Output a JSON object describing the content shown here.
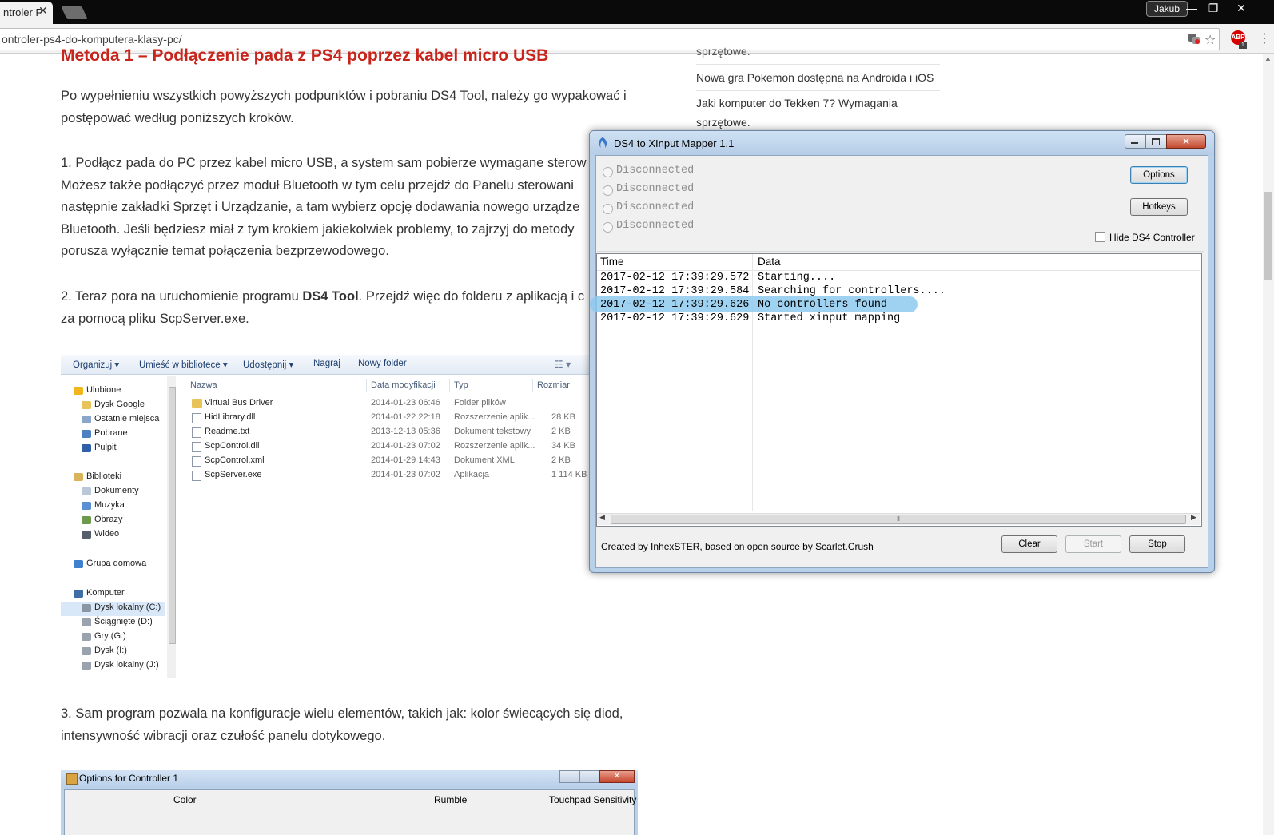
{
  "browser": {
    "tab_title": "ntroler P",
    "tab_close": "✕",
    "url": "ontroler-ps4-do-komputera-klasy-pc/",
    "profile": "Jakub",
    "controls": {
      "minimize": "—",
      "restore": "❐",
      "close": "✕"
    },
    "abp_label": "ABP",
    "abp_badge": "1"
  },
  "article": {
    "heading": "Metoda 1 – Podłączenie pada z PS4 poprzez kabel micro USB",
    "intro": [
      "Po wypełnieniu wszystkich powyższych podpunktów i pobraniu DS4 Tool, należy go wypakować i",
      "postępować według poniższych kroków."
    ],
    "step1": [
      "1. Podłącz pada do PC przez kabel micro USB, a system sam pobierze wymagane sterow",
      "Możesz także podłączyć przez moduł Bluetooth w tym celu przejdź do Panelu sterowani",
      "następnie zakładki Sprzęt i Urządzanie, a tam wybierz opcję dodawania nowego urządze",
      "Bluetooth. Jeśli będziesz miał z tym krokiem jakiekolwiek problemy, to zajrzyj do metody",
      "porusza wyłącznie temat połączenia bezprzewodowego."
    ],
    "step2": {
      "pre": "2. Teraz pora na uruchomienie programu ",
      "bold": "DS4 Tool",
      "post": ". Przejdź więc do folderu z aplikacją i c",
      "line2": "za pomocą pliku ScpServer.exe."
    },
    "step3": [
      "3. Sam program pozwala na konfiguracje wielu elementów, takich jak: kolor świecących się diod,",
      "intensywność wibracji oraz czułość panelu dotykowego."
    ]
  },
  "sidebar": {
    "items": [
      "sprzętowe.",
      "Nowa gra Pokemon dostępna na Androida i iOS",
      "Jaki komputer do Tekken 7? Wymagania",
      "sprzętowe."
    ]
  },
  "explorer": {
    "toolbar": [
      "Organizuj ▾",
      "Umieść w bibliotece ▾",
      "Udostępnij ▾",
      "Nagraj",
      "Nowy folder"
    ],
    "columns": [
      "Nazwa",
      "Data modyfikacji",
      "Typ",
      "Rozmiar"
    ],
    "nav": [
      {
        "label": "Ulubione",
        "icon": "star-icon",
        "color": "#f3b51c",
        "indent": 0
      },
      {
        "label": "Dysk Google",
        "icon": "folder-icon",
        "color": "#e8c35a",
        "indent": 1
      },
      {
        "label": "Ostatnie miejsca",
        "icon": "folder-icon",
        "color": "#8aa6c8",
        "indent": 1
      },
      {
        "label": "Pobrane",
        "icon": "folder-icon",
        "color": "#4c7fc4",
        "indent": 1
      },
      {
        "label": "Pulpit",
        "icon": "folder-icon",
        "color": "#2f5fa6",
        "indent": 1
      },
      {
        "label": "Biblioteki",
        "icon": "library-icon",
        "color": "#d9b45a",
        "indent": 0
      },
      {
        "label": "Dokumenty",
        "icon": "document-icon",
        "color": "#b9c7d8",
        "indent": 1
      },
      {
        "label": "Muzyka",
        "icon": "music-icon",
        "color": "#5a8fd6",
        "indent": 1
      },
      {
        "label": "Obrazy",
        "icon": "image-icon",
        "color": "#6b9a4a",
        "indent": 1
      },
      {
        "label": "Wideo",
        "icon": "video-icon",
        "color": "#555e6a",
        "indent": 1
      },
      {
        "label": "Grupa domowa",
        "icon": "homegroup-icon",
        "color": "#3f7fcf",
        "indent": 0
      },
      {
        "label": "Komputer",
        "icon": "computer-icon",
        "color": "#3e6ea6",
        "indent": 0
      },
      {
        "label": "Dysk lokalny (C:)",
        "icon": "drive-icon",
        "color": "#8a96a4",
        "indent": 1,
        "selected": true
      },
      {
        "label": "Ściągnięte (D:)",
        "icon": "drive-icon",
        "color": "#9aa3ad",
        "indent": 1
      },
      {
        "label": "Gry (G:)",
        "icon": "drive-icon",
        "color": "#9aa3ad",
        "indent": 1
      },
      {
        "label": "Dysk (I:)",
        "icon": "drive-icon",
        "color": "#9aa3ad",
        "indent": 1
      },
      {
        "label": "Dysk lokalny (J:)",
        "icon": "drive-icon",
        "color": "#9aa3ad",
        "indent": 1
      }
    ],
    "files": [
      {
        "name": "Virtual Bus Driver",
        "date": "2014-01-23 06:46",
        "type": "Folder plików",
        "size": "",
        "icon": "folder-icon"
      },
      {
        "name": "HidLibrary.dll",
        "date": "2014-01-22 22:18",
        "type": "Rozszerzenie aplik...",
        "size": "28 KB",
        "icon": "dll-icon"
      },
      {
        "name": "Readme.txt",
        "date": "2013-12-13 05:36",
        "type": "Dokument tekstowy",
        "size": "2 KB",
        "icon": "text-file-icon"
      },
      {
        "name": "ScpControl.dll",
        "date": "2014-01-23 07:02",
        "type": "Rozszerzenie aplik...",
        "size": "34 KB",
        "icon": "dll-icon"
      },
      {
        "name": "ScpControl.xml",
        "date": "2014-01-29 14:43",
        "type": "Dokument XML",
        "size": "2 KB",
        "icon": "xml-file-icon"
      },
      {
        "name": "ScpServer.exe",
        "date": "2014-01-23 07:02",
        "type": "Aplikacja",
        "size": "1 114 KB",
        "icon": "exe-icon"
      }
    ]
  },
  "options_window": {
    "title": "Options for Controller 1",
    "columns": [
      "Color",
      "Rumble",
      "Touchpad Sensitivity"
    ]
  },
  "ds4_window": {
    "title": "DS4 to XInput Mapper 1.1",
    "controllers": [
      "Disconnected",
      "Disconnected",
      "Disconnected",
      "Disconnected"
    ],
    "options_btn": "Options",
    "hotkeys_btn": "Hotkeys",
    "hide_label": "Hide DS4 Controller",
    "log_headers": [
      "Time",
      "Data"
    ],
    "log": [
      {
        "time": "2017-02-12 17:39:29.572",
        "data": "Starting...."
      },
      {
        "time": "2017-02-12 17:39:29.584",
        "data": "Searching for controllers...."
      },
      {
        "time": "2017-02-12 17:39:29.626",
        "data": "No controllers found"
      },
      {
        "time": "2017-02-12 17:39:29.629",
        "data": "Started xinput mapping"
      }
    ],
    "credit": "Created by InhexSTER,  based on open source by Scarlet.Crush",
    "clear_btn": "Clear",
    "start_btn": "Start",
    "stop_btn": "Stop",
    "scroll_grip": "⦀"
  }
}
